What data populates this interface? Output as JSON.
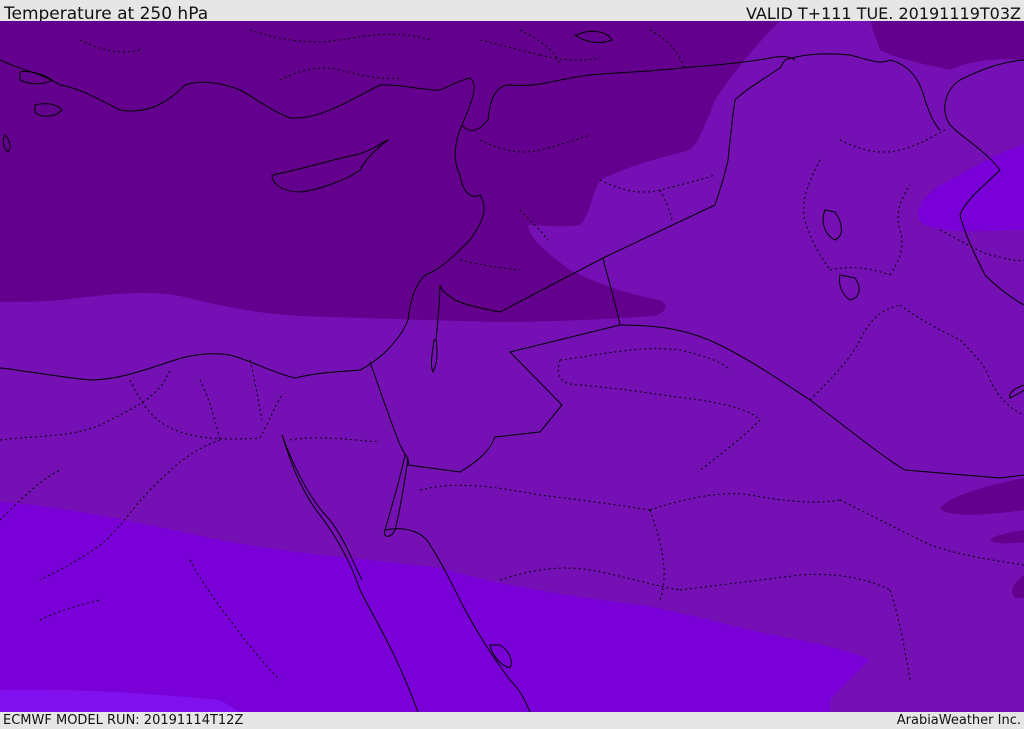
{
  "header": {
    "title": "Temperature at 250 hPa",
    "valid": "VALID T+111 TUE. 20191119T03Z"
  },
  "footer": {
    "model_run": "ECMWF MODEL RUN: 20191114T12Z",
    "credit": "ArabiaWeather Inc."
  },
  "map": {
    "colors": {
      "band_darkest": "#64008e",
      "band_dark": "#6e08a6",
      "band_mid": "#7410b4",
      "band_bright": "#7a00d8",
      "band_brightest": "#8010ee",
      "boundary_line": "#000000"
    }
  }
}
